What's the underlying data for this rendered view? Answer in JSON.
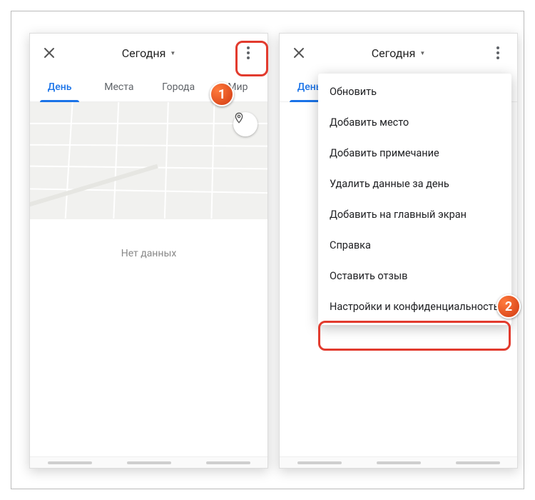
{
  "left": {
    "title": "Сегодня",
    "tabs": [
      "День",
      "Места",
      "Города",
      "Мир"
    ],
    "active_tab_index": 0,
    "no_data": "Нет данных"
  },
  "right": {
    "title": "Сегодня",
    "tabs": [
      "День"
    ],
    "active_tab_index": 0,
    "menu": [
      "Обновить",
      "Добавить место",
      "Добавить примечание",
      "Удалить данные за день",
      "Добавить на главный экран",
      "Справка",
      "Оставить отзыв",
      "Настройки и конфиденциальность"
    ],
    "highlighted_menu_index": 7
  },
  "annotations": {
    "step1": "1",
    "step2": "2"
  }
}
